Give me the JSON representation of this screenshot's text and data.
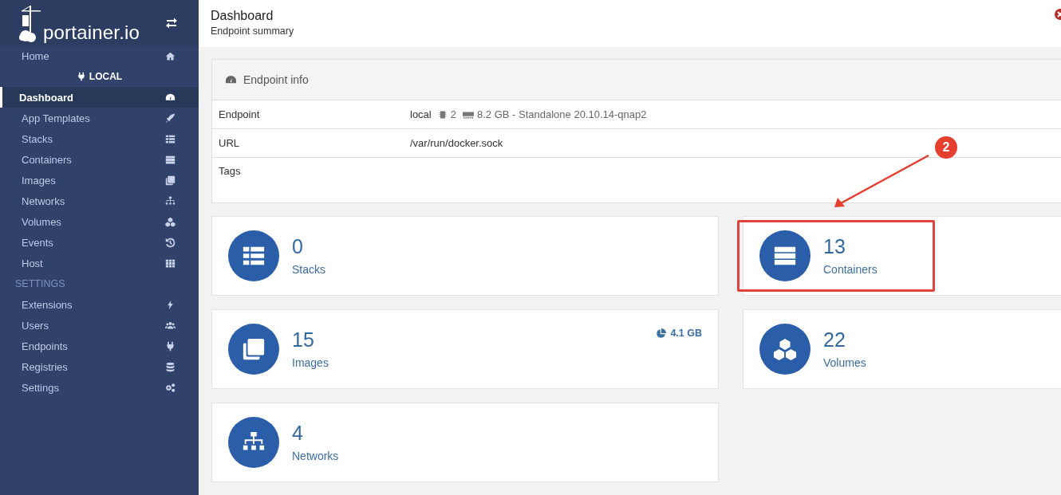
{
  "sidebar": {
    "logo": "portainer.io",
    "items": [
      {
        "kind": "item",
        "label": "Home",
        "selected": false
      },
      {
        "kind": "endpoint",
        "label": "LOCAL"
      },
      {
        "kind": "item",
        "label": "Dashboard",
        "selected": true
      },
      {
        "kind": "item",
        "label": "App Templates",
        "selected": false
      },
      {
        "kind": "item",
        "label": "Stacks",
        "selected": false
      },
      {
        "kind": "item",
        "label": "Containers",
        "selected": false
      },
      {
        "kind": "item",
        "label": "Images",
        "selected": false
      },
      {
        "kind": "item",
        "label": "Networks",
        "selected": false
      },
      {
        "kind": "item",
        "label": "Volumes",
        "selected": false
      },
      {
        "kind": "item",
        "label": "Events",
        "selected": false
      },
      {
        "kind": "item",
        "label": "Host",
        "selected": false
      },
      {
        "kind": "heading",
        "label": "SETTINGS"
      },
      {
        "kind": "item",
        "label": "Extensions",
        "selected": false
      },
      {
        "kind": "item",
        "label": "Users",
        "selected": false
      },
      {
        "kind": "item",
        "label": "Endpoints",
        "selected": false
      },
      {
        "kind": "item",
        "label": "Registries",
        "selected": false
      },
      {
        "kind": "item",
        "label": "Settings",
        "selected": false
      }
    ]
  },
  "header": {
    "title": "Dashboard",
    "subtitle": "Endpoint summary"
  },
  "endpoint_info": {
    "title": "Endpoint info",
    "rows": [
      {
        "label": "Endpoint",
        "value": "local",
        "cpu": "2",
        "memory": "8.2 GB - Standalone 20.10.14-qnap2"
      },
      {
        "label": "URL",
        "value": "/var/run/docker.sock"
      },
      {
        "label": "Tags"
      }
    ]
  },
  "cards": [
    {
      "count": "0",
      "label": "Stacks",
      "highlighted": false
    },
    {
      "count": "13",
      "label": "Containers",
      "highlighted": true
    },
    {
      "count": "15",
      "label": "Images",
      "size": "4.1 GB",
      "highlighted": false
    },
    {
      "count": "22",
      "label": "Volumes",
      "highlighted": false
    },
    {
      "count": "4",
      "label": "Networks",
      "highlighted": false
    }
  ],
  "annotation": {
    "badge": "2"
  }
}
